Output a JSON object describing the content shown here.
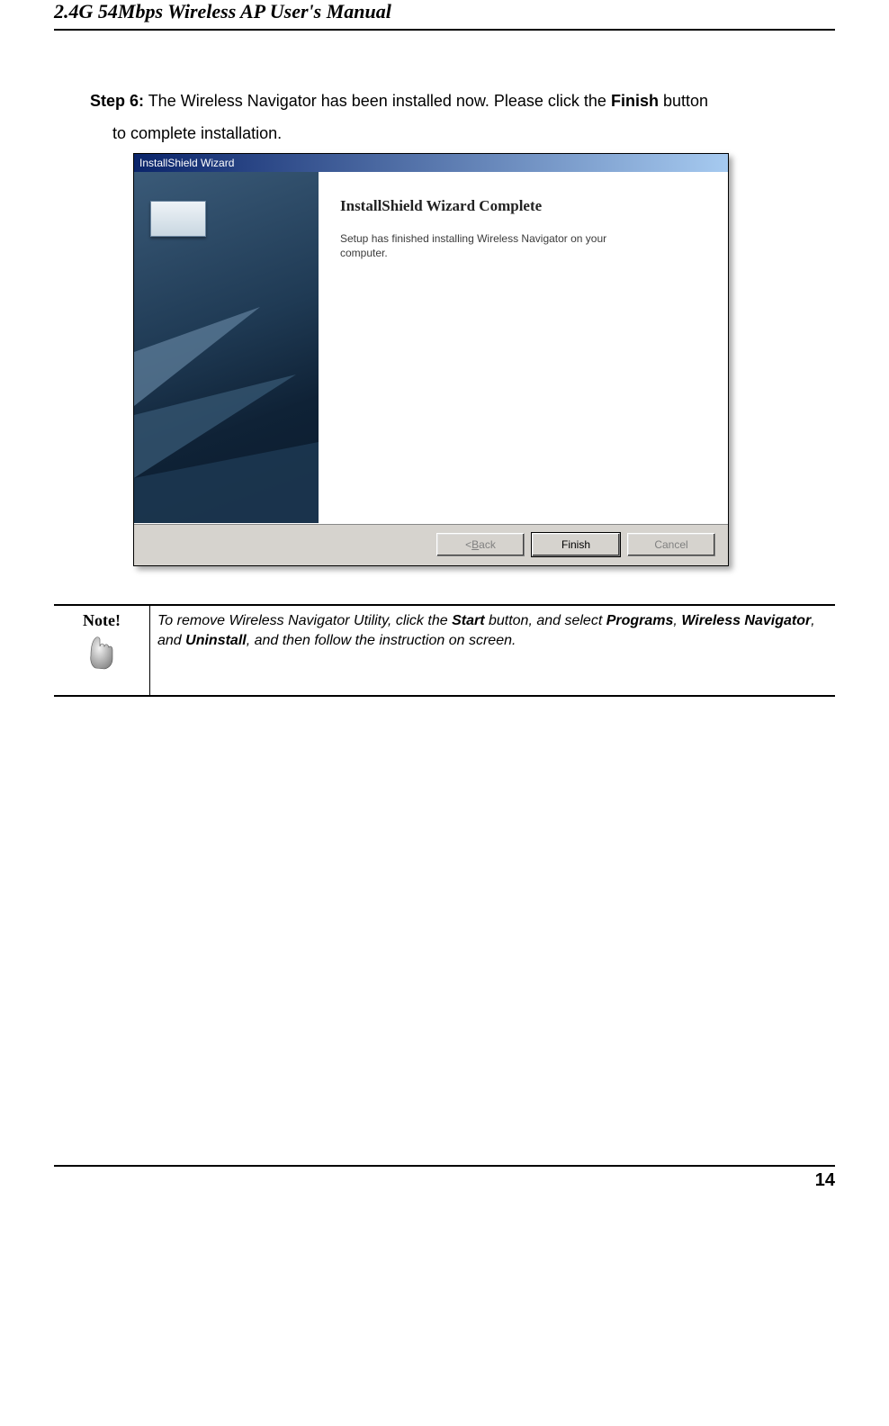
{
  "header": {
    "title": "2.4G 54Mbps Wireless AP User's Manual"
  },
  "body": {
    "step_label": "Step 6:",
    "step_text_1": " The Wireless Navigator has been installed now. Please click the ",
    "finish_word": "Finish",
    "step_text_2": " button",
    "step_text_line2": "to complete installation."
  },
  "wizard": {
    "titlebar": "InstallShield Wizard",
    "main_title": "InstallShield Wizard Complete",
    "main_text_line1": "Setup has finished installing Wireless Navigator on your",
    "main_text_line2": "computer.",
    "buttons": {
      "back_prefix": "< ",
      "back_u": "B",
      "back_suffix": "ack",
      "finish": "Finish",
      "cancel": "Cancel"
    }
  },
  "note": {
    "label": "Note!",
    "text_prefix": "To remove Wireless Navigator Utility, click the ",
    "start": "Start",
    "text_mid1": " button, and select ",
    "programs": "Programs",
    "text_mid1b": ", ",
    "wn": "Wireless Navigator",
    "text_mid2": ", and ",
    "uninstall": "Uninstall",
    "text_suffix": ", and then follow the instruction on screen."
  },
  "footer": {
    "page_number": "14"
  }
}
